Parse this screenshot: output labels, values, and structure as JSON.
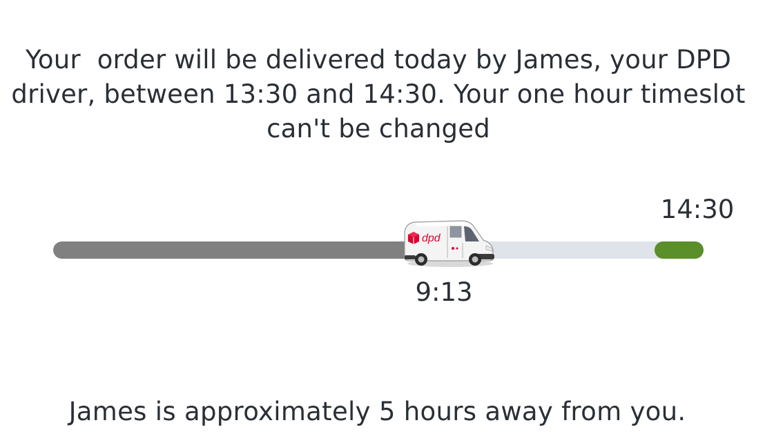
{
  "delivery": {
    "message": "Your  order will be delivered today by James, your DPD driver, between 13:30 and 14:30. Your one hour timeslot can't be changed",
    "end_time": "14:30",
    "current_time": "9:13",
    "eta": "James is approximately 5 hours away from you."
  },
  "progress": {
    "fill_fraction": 0.55,
    "slot_start_fraction": 0.924,
    "track_color": "#dfe3ea",
    "fill_color": "#808080",
    "slot_color": "#5a8f29"
  },
  "van": {
    "icon": "dpd-van-icon",
    "logo_text": "dpd",
    "logo_color": "#dc0032"
  }
}
